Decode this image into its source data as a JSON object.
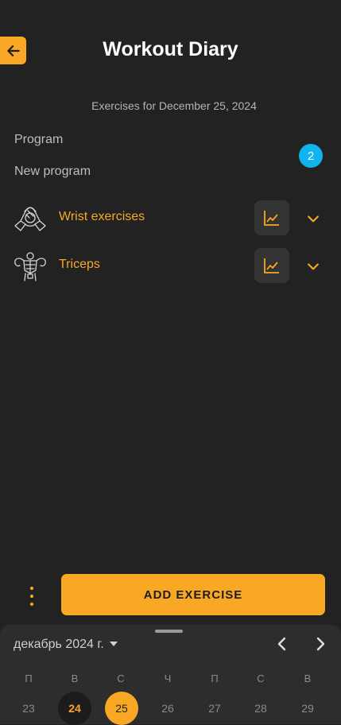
{
  "header": {
    "title": "Workout Diary"
  },
  "subtitle": "Exercises for December 25, 2024",
  "program": {
    "label": "Program",
    "value": "New program",
    "badge": "2"
  },
  "exercises": [
    {
      "name": "Wrist exercises",
      "icon": "wrist-exercise-icon"
    },
    {
      "name": "Triceps",
      "icon": "triceps-icon"
    }
  ],
  "actions": {
    "add_exercise": "ADD EXERCISE"
  },
  "calendar": {
    "month": "декабрь 2024 г.",
    "weekdays": [
      "П",
      "В",
      "С",
      "Ч",
      "П",
      "С",
      "В"
    ],
    "days": [
      "23",
      "24",
      "25",
      "26",
      "27",
      "28",
      "29"
    ],
    "today": "24",
    "selected": "25"
  },
  "colors": {
    "accent": "#f9a825",
    "background": "#222222",
    "badge": "#11b5ee"
  }
}
